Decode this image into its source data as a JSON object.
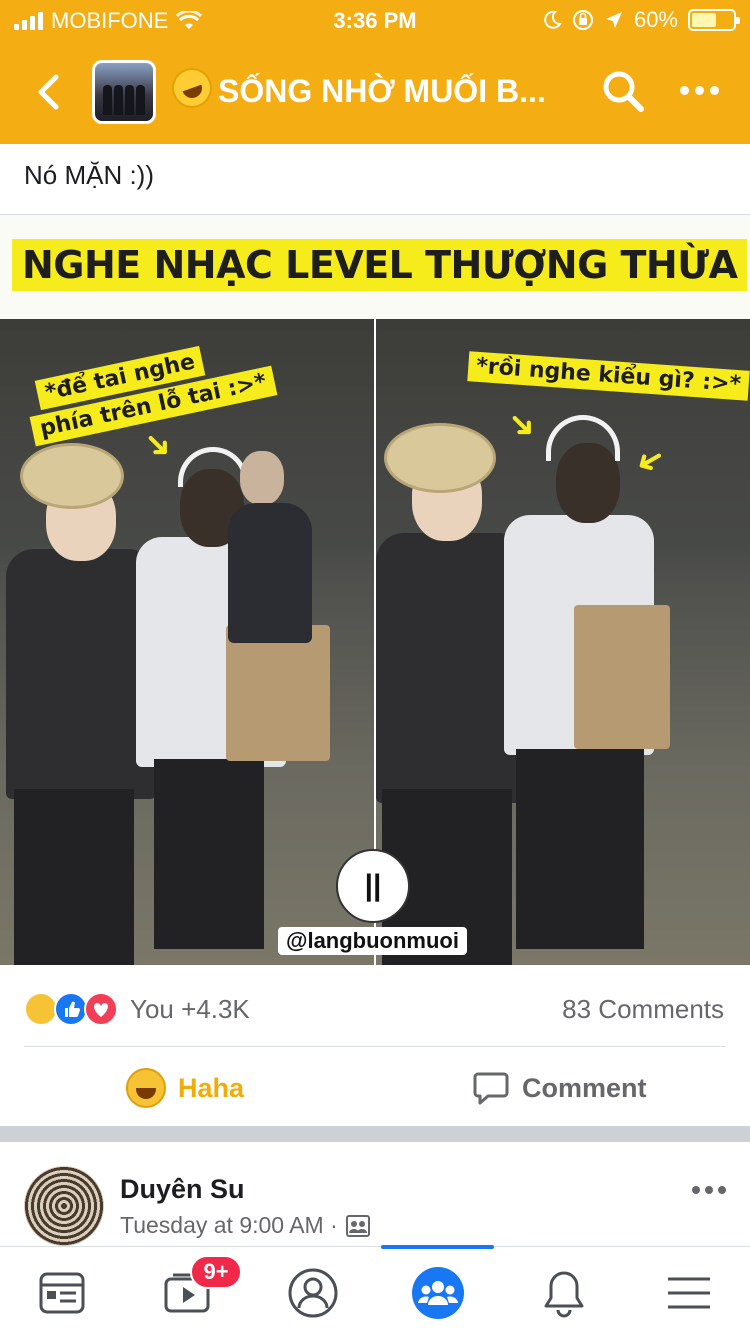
{
  "status_bar": {
    "carrier": "MOBIFONE",
    "time": "3:36 PM",
    "battery_percent": "60%",
    "battery_level": 0.6
  },
  "header": {
    "group_title": "SỐNG NHỜ MUỐI B...",
    "title_emoji": "rofl-emoji",
    "background_color": "#f5ad14"
  },
  "post": {
    "caption": "Nó MẶN :))",
    "image": {
      "headline": "NGHE NHẠC LEVEL THƯỢNG THỪA",
      "left_note_line1": "*để tai nghe",
      "left_note_line2": "phía trên lỗ tai :>*",
      "right_note": "*rồi nghe kiểu gì? :>*",
      "watermark": "@langbuonmuoi"
    },
    "reactions": {
      "icons": [
        "haha-icon",
        "like-icon",
        "love-icon"
      ],
      "summary": "You +4.3K",
      "comments": "83 Comments"
    },
    "actions": {
      "react_label": "Haha",
      "comment_label": "Comment"
    }
  },
  "next_post": {
    "author": "Duyên Su",
    "time": "Tuesday at 9:00 AM ·"
  },
  "tabbar": {
    "items": [
      "news-feed-icon",
      "watch-icon",
      "profile-icon",
      "groups-icon",
      "notifications-icon",
      "menu-icon"
    ],
    "active": "groups-icon",
    "watch_badge": "9+",
    "accent_color": "#1877f2"
  }
}
